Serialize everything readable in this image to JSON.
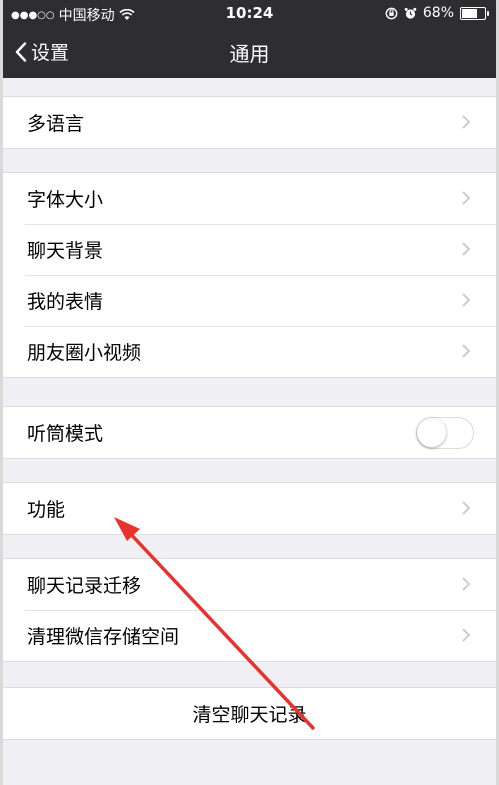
{
  "status_bar": {
    "carrier": "中国移动",
    "time": "10:24",
    "battery": "68%",
    "battery_level": 0.68
  },
  "nav": {
    "back_label": "设置",
    "title": "通用"
  },
  "groups": [
    {
      "items": [
        {
          "label": "多语言"
        }
      ]
    },
    {
      "items": [
        {
          "label": "字体大小"
        },
        {
          "label": "聊天背景"
        },
        {
          "label": "我的表情"
        },
        {
          "label": "朋友圈小视频"
        }
      ]
    },
    {
      "items": [
        {
          "label": "听筒模式",
          "toggle": false
        }
      ]
    },
    {
      "items": [
        {
          "label": "功能"
        }
      ]
    },
    {
      "items": [
        {
          "label": "聊天记录迁移"
        },
        {
          "label": "清理微信存储空间"
        }
      ]
    },
    {
      "items": [
        {
          "label": "清空聊天记录"
        }
      ]
    }
  ],
  "colors": {
    "nav_bg": "#2e2e31",
    "page_bg": "#efeff4",
    "annotation_arrow": "#e8322e"
  }
}
